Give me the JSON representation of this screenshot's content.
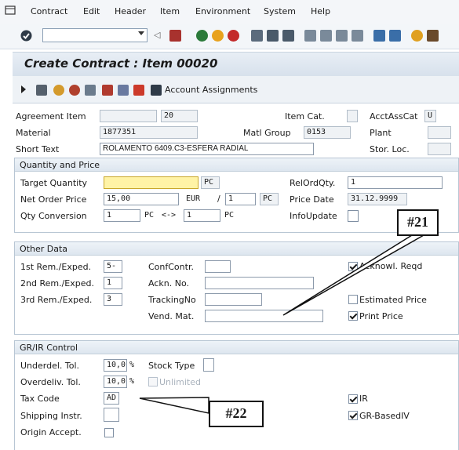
{
  "menu": {
    "contract": "Contract",
    "edit": "Edit",
    "header": "Header",
    "item": "Item",
    "environment": "Environment",
    "system": "System",
    "help": "Help"
  },
  "title": "Create Contract : Item 00020",
  "app_toolbar": {
    "account_assignments": "Account Assignments"
  },
  "top": {
    "agreement_item_label": "Agreement Item",
    "agreement_item_value": "20",
    "item_cat_label": "Item Cat.",
    "acct_ass_cat_label": "AcctAssCat",
    "acct_ass_cat_value": "U",
    "material_label": "Material",
    "material_value": "1877351",
    "matl_group_label": "Matl Group",
    "matl_group_value": "0153",
    "plant_label": "Plant",
    "short_text_label": "Short Text",
    "short_text_value": "ROLAMENTO 6409.C3-ESFERA RADIAL",
    "stor_loc_label": "Stor. Loc."
  },
  "qp": {
    "title": "Quantity and Price",
    "target_qty_label": "Target Quantity",
    "target_qty_unit": "PC",
    "rel_ord_qty_label": "RelOrdQty.",
    "rel_ord_qty_value": "1",
    "net_price_label": "Net Order Price",
    "net_price_value": "15,00",
    "currency": "EUR",
    "per_sep": "/",
    "per_value": "1",
    "per_unit": "PC",
    "price_date_label": "Price Date",
    "price_date_value": "31.12.9999",
    "qty_conv_label": "Qty Conversion",
    "qty_conv_a": "1",
    "qty_conv_unit_a": "PC",
    "qty_conv_arrow": "<->",
    "qty_conv_b": "1",
    "qty_conv_unit_b": "PC",
    "info_update_label": "InfoUpdate"
  },
  "od": {
    "title": "Other Data",
    "rem1_label": "1st Rem./Exped.",
    "rem1_value": "5-",
    "rem2_label": "2nd Rem./Exped.",
    "rem2_value": "1",
    "rem3_label": "3rd Rem./Exped.",
    "rem3_value": "3",
    "conf_contr_label": "ConfContr.",
    "ackn_no_label": "Ackn. No.",
    "tracking_label": "TrackingNo",
    "vend_mat_label": "Vend. Mat.",
    "acknowl_label": "Acknowl. Reqd",
    "est_price_label": "Estimated Price",
    "print_price_label": "Print Price"
  },
  "gr": {
    "title": "GR/IR Control",
    "underdel_label": "Underdel. Tol.",
    "underdel_value": "10,0",
    "pct": "%",
    "overdel_label": "Overdeliv. Tol.",
    "overdel_value": "10,0",
    "unlimited_label": "Unlimited",
    "stock_type_label": "Stock Type",
    "tax_code_label": "Tax Code",
    "tax_code_value": "AD",
    "shipping_label": "Shipping Instr.",
    "origin_label": "Origin Accept.",
    "ir_label": "IR",
    "gr_based_label": "GR-BasedIV"
  },
  "callouts": {
    "c21": "#21",
    "c22": "#22"
  },
  "colors": {
    "title_bg": "#dbe4ee",
    "highlight": "#fff3a6",
    "group_border": "#b8c6d4"
  }
}
